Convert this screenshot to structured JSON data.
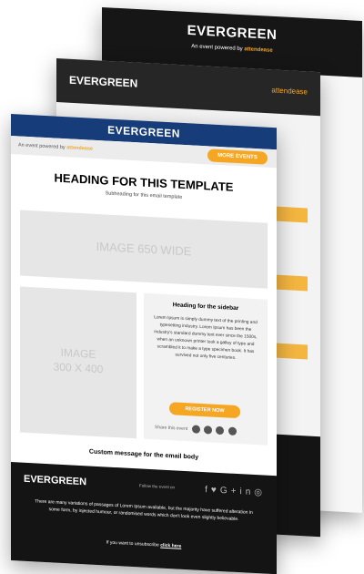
{
  "back": {
    "logo": "EVERGREEN",
    "powered": "An event powered by",
    "brand": "attendease"
  },
  "mid": {
    "logo": "EVERGREEN",
    "brand": "attendease"
  },
  "front": {
    "logo": "EVERGREEN",
    "powered": "An event powered by",
    "brand": "attendease",
    "more_events": "MORE EVENTS",
    "heading": "HEADING FOR THIS TEMPLATE",
    "subheading": "Subheading for this email template",
    "wide_image": "IMAGE 650 WIDE",
    "image300_line1": "IMAGE",
    "image300_line2": "300 X 400",
    "sidebar_heading": "Heading for the sidebar",
    "sidebar_text": "Lorem Ipsum is simply dummy text of the printing and typesetting industry. Lorem Ipsum has been the industry's standard dummy text ever since the 1500s, when an unknown printer took a galley of type and scrambled it to make a type specimen book. It has survived not only five centuries.",
    "register_now": "REGISTER NOW",
    "share_label": "Share this event",
    "custom_message": "Custom message for the email body",
    "footer_logo": "EVERGREEN",
    "follow": "Follow the event on",
    "footer_text": "There are many variations of passages of Lorem Ipsum available, but the majority have suffered alteration in some form, by injected humour, or randomised words which don't look even slightly believable.",
    "unsub_prefix": "If you want to unsubscribe",
    "unsub_link": "click here"
  },
  "colors": {
    "accent": "#f5a623",
    "header_blue": "#173c7a",
    "dark": "#141414"
  }
}
